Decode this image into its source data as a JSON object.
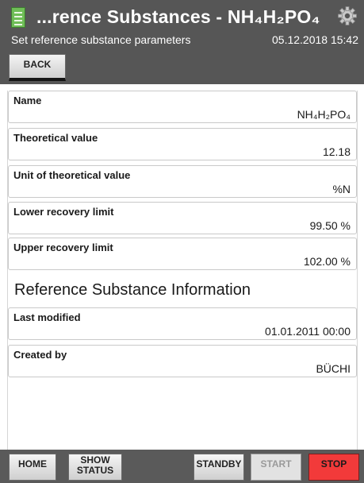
{
  "header": {
    "title": "...rence Substances - NH₄H₂PO₄",
    "subtitle": "Set reference substance parameters",
    "datetime": "05.12.2018 15:42",
    "app_icon": "document-icon",
    "settings_icon": "gear-icon",
    "back_label": "BACK"
  },
  "fields": [
    {
      "label": "Name",
      "value": "NH₄H₂PO₄"
    },
    {
      "label": "Theoretical value",
      "value": "12.18"
    },
    {
      "label": "Unit of theoretical value",
      "value": "%N"
    },
    {
      "label": "Lower recovery limit",
      "value": "99.50 %"
    },
    {
      "label": "Upper recovery limit",
      "value": "102.00 %"
    }
  ],
  "info": {
    "heading": "Reference Substance Information",
    "fields": [
      {
        "label": "Last modified",
        "value": "01.01.2011 00:00"
      },
      {
        "label": "Created by",
        "value": "BÜCHI"
      }
    ]
  },
  "footer": {
    "home": "HOME",
    "show_status_line1": "SHOW",
    "show_status_line2": "STATUS",
    "standby": "STANDBY",
    "start": "START",
    "stop": "STOP"
  },
  "colors": {
    "header_bg": "#565656",
    "stop_button": "#f23a3a",
    "app_icon": "#6fbe57",
    "gear_icon": "#c8c8c8"
  }
}
